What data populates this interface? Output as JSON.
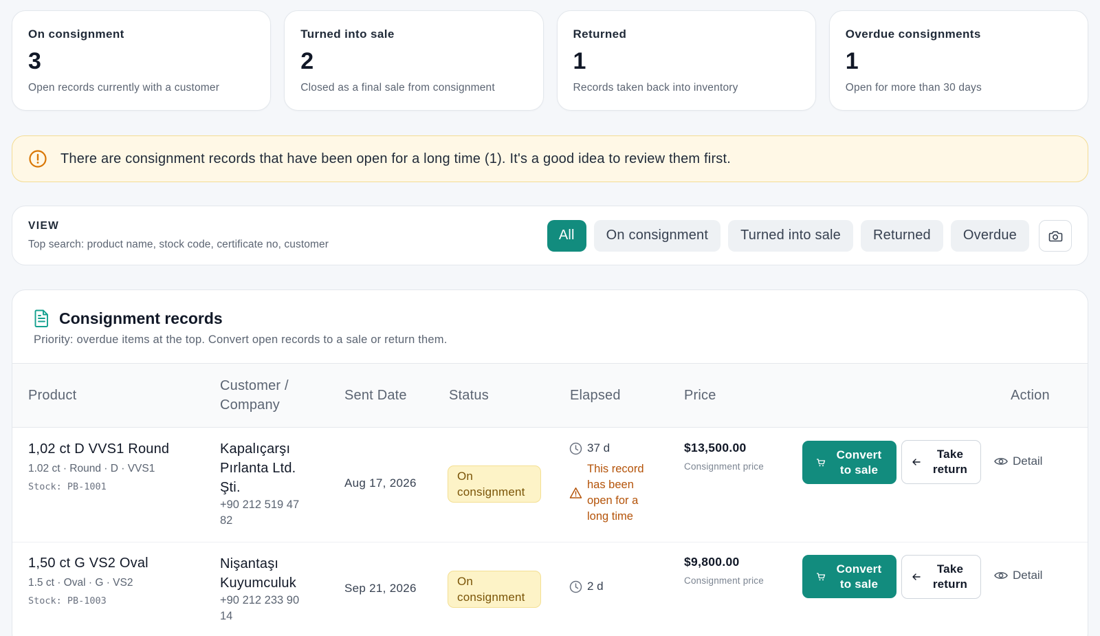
{
  "stats": [
    {
      "label": "On consignment",
      "value": "3",
      "sub": "Open records currently with a customer"
    },
    {
      "label": "Turned into sale",
      "value": "2",
      "sub": "Closed as a final sale from consignment"
    },
    {
      "label": "Returned",
      "value": "1",
      "sub": "Records taken back into inventory"
    },
    {
      "label": "Overdue consignments",
      "value": "1",
      "sub": "Open for more than 30 days"
    }
  ],
  "alert": {
    "icon": "alert-circle-icon",
    "text": "There are consignment records that have been open for a long time (1). It's a good idea to review them first."
  },
  "view": {
    "title": "VIEW",
    "subtitle": "Top search: product name, stock code, certificate no, customer",
    "filters": [
      "All",
      "On consignment",
      "Turned into sale",
      "Returned",
      "Overdue"
    ],
    "active_filter": "All",
    "camera_icon": "camera-icon"
  },
  "records": {
    "title": "Consignment records",
    "subtitle": "Priority: overdue items at the top. Convert open records to a sale or return them.",
    "columns": {
      "product": "Product",
      "customer": "Customer /\nCompany",
      "sent_date": "Sent Date",
      "status": "Status",
      "elapsed": "Elapsed",
      "price": "Price",
      "action": "Action"
    },
    "rows": [
      {
        "product": "1,02 ct D VVS1 Round",
        "meta": "1.02 ct · Round · D · VVS1",
        "stock": "Stock: PB-1001",
        "customer": "Kapalıçarşı\nPırlanta Ltd.\nŞti.",
        "phone": "+90 212 519 47\n82",
        "sent_date": "Aug 17, 2026",
        "status": "On\nconsignment",
        "elapsed": "37 d",
        "warning": "This record\nhas been\nopen for a\nlong time",
        "price": "$13,500.00",
        "price_sub": "Consignment price",
        "convert": "Convert\nto sale",
        "return": "Take\nreturn",
        "detail": "Detail"
      },
      {
        "product": "1,50 ct G VS2 Oval",
        "meta": "1.5 ct · Oval · G · VS2",
        "stock": "Stock: PB-1003",
        "customer": "Nişantaşı\nKuyumculuk",
        "phone": "+90 212 233 90\n14",
        "sent_date": "Sep 21, 2026",
        "status": "On\nconsignment",
        "elapsed": "2 d",
        "warning": "",
        "price": "$9,800.00",
        "price_sub": "Consignment price",
        "convert": "Convert\nto sale",
        "return": "Take\nreturn",
        "detail": "Detail"
      }
    ]
  },
  "colors": {
    "accent": "#128c7e",
    "warning_bg": "#fff8e6",
    "warning_text": "#b45309",
    "badge_bg": "#fdf3c7"
  }
}
